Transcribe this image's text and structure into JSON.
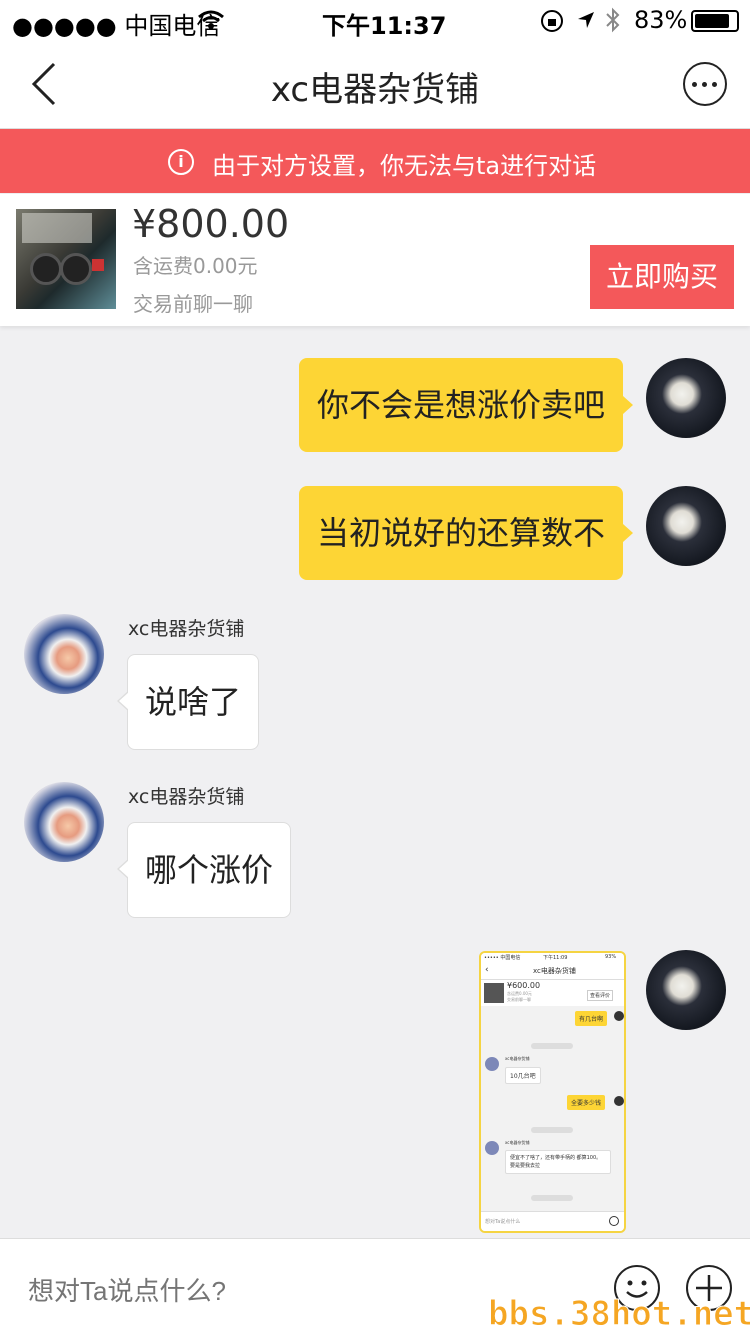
{
  "status_bar": {
    "carrier": "●●●●● 中国电信",
    "time": "下午11:37",
    "battery": "83%"
  },
  "nav": {
    "title": "xc电器杂货铺"
  },
  "banner": {
    "icon_text": "i",
    "text": "由于对方设置，你无法与ta进行对话"
  },
  "product": {
    "price": "¥800.00",
    "shipping": "含运费0.00元",
    "chat_hint": "交易前聊一聊",
    "buy_label": "立即购买"
  },
  "messages": [
    {
      "from": "me",
      "text": "你不会是想涨价卖吧"
    },
    {
      "from": "me",
      "text": "当初说好的还算数不"
    },
    {
      "from": "shop",
      "sender": "xc电器杂货铺",
      "text": "说啥了"
    },
    {
      "from": "shop",
      "sender": "xc电器杂货铺",
      "text": "哪个涨价"
    }
  ],
  "mini_screenshot": {
    "status_left": "••••• 中国电信",
    "status_time": "下午11:09",
    "status_right": "93%",
    "title": "xc电器杂货铺",
    "price": "¥600.00",
    "ship": "含运费0.00元",
    "chat_hint": "交易前聊一聊",
    "review_btn": "查看评价",
    "msg1": "有几台啊",
    "sender1": "xc电器杂货铺",
    "reply1": "10几台吧",
    "msg2": "全要多少钱",
    "sender2": "xc电器杂货铺",
    "reply2": "便宜不了啥了，还有带手柄的 都算100。要是要我去拉",
    "input_placeholder": "想对Ta说点什么"
  },
  "input": {
    "placeholder": "想对Ta说点什么?"
  },
  "watermark": "bbs.38hot.net",
  "colors": {
    "banner_red": "#f4585a",
    "my_bubble_yellow": "#fdd535",
    "background": "#f0f0f2"
  },
  "icons": [
    "back-chevron-icon",
    "more-icon",
    "info-icon",
    "emoji-icon",
    "plus-icon",
    "wifi-icon",
    "location-icon",
    "bluetooth-icon",
    "battery-icon"
  ]
}
